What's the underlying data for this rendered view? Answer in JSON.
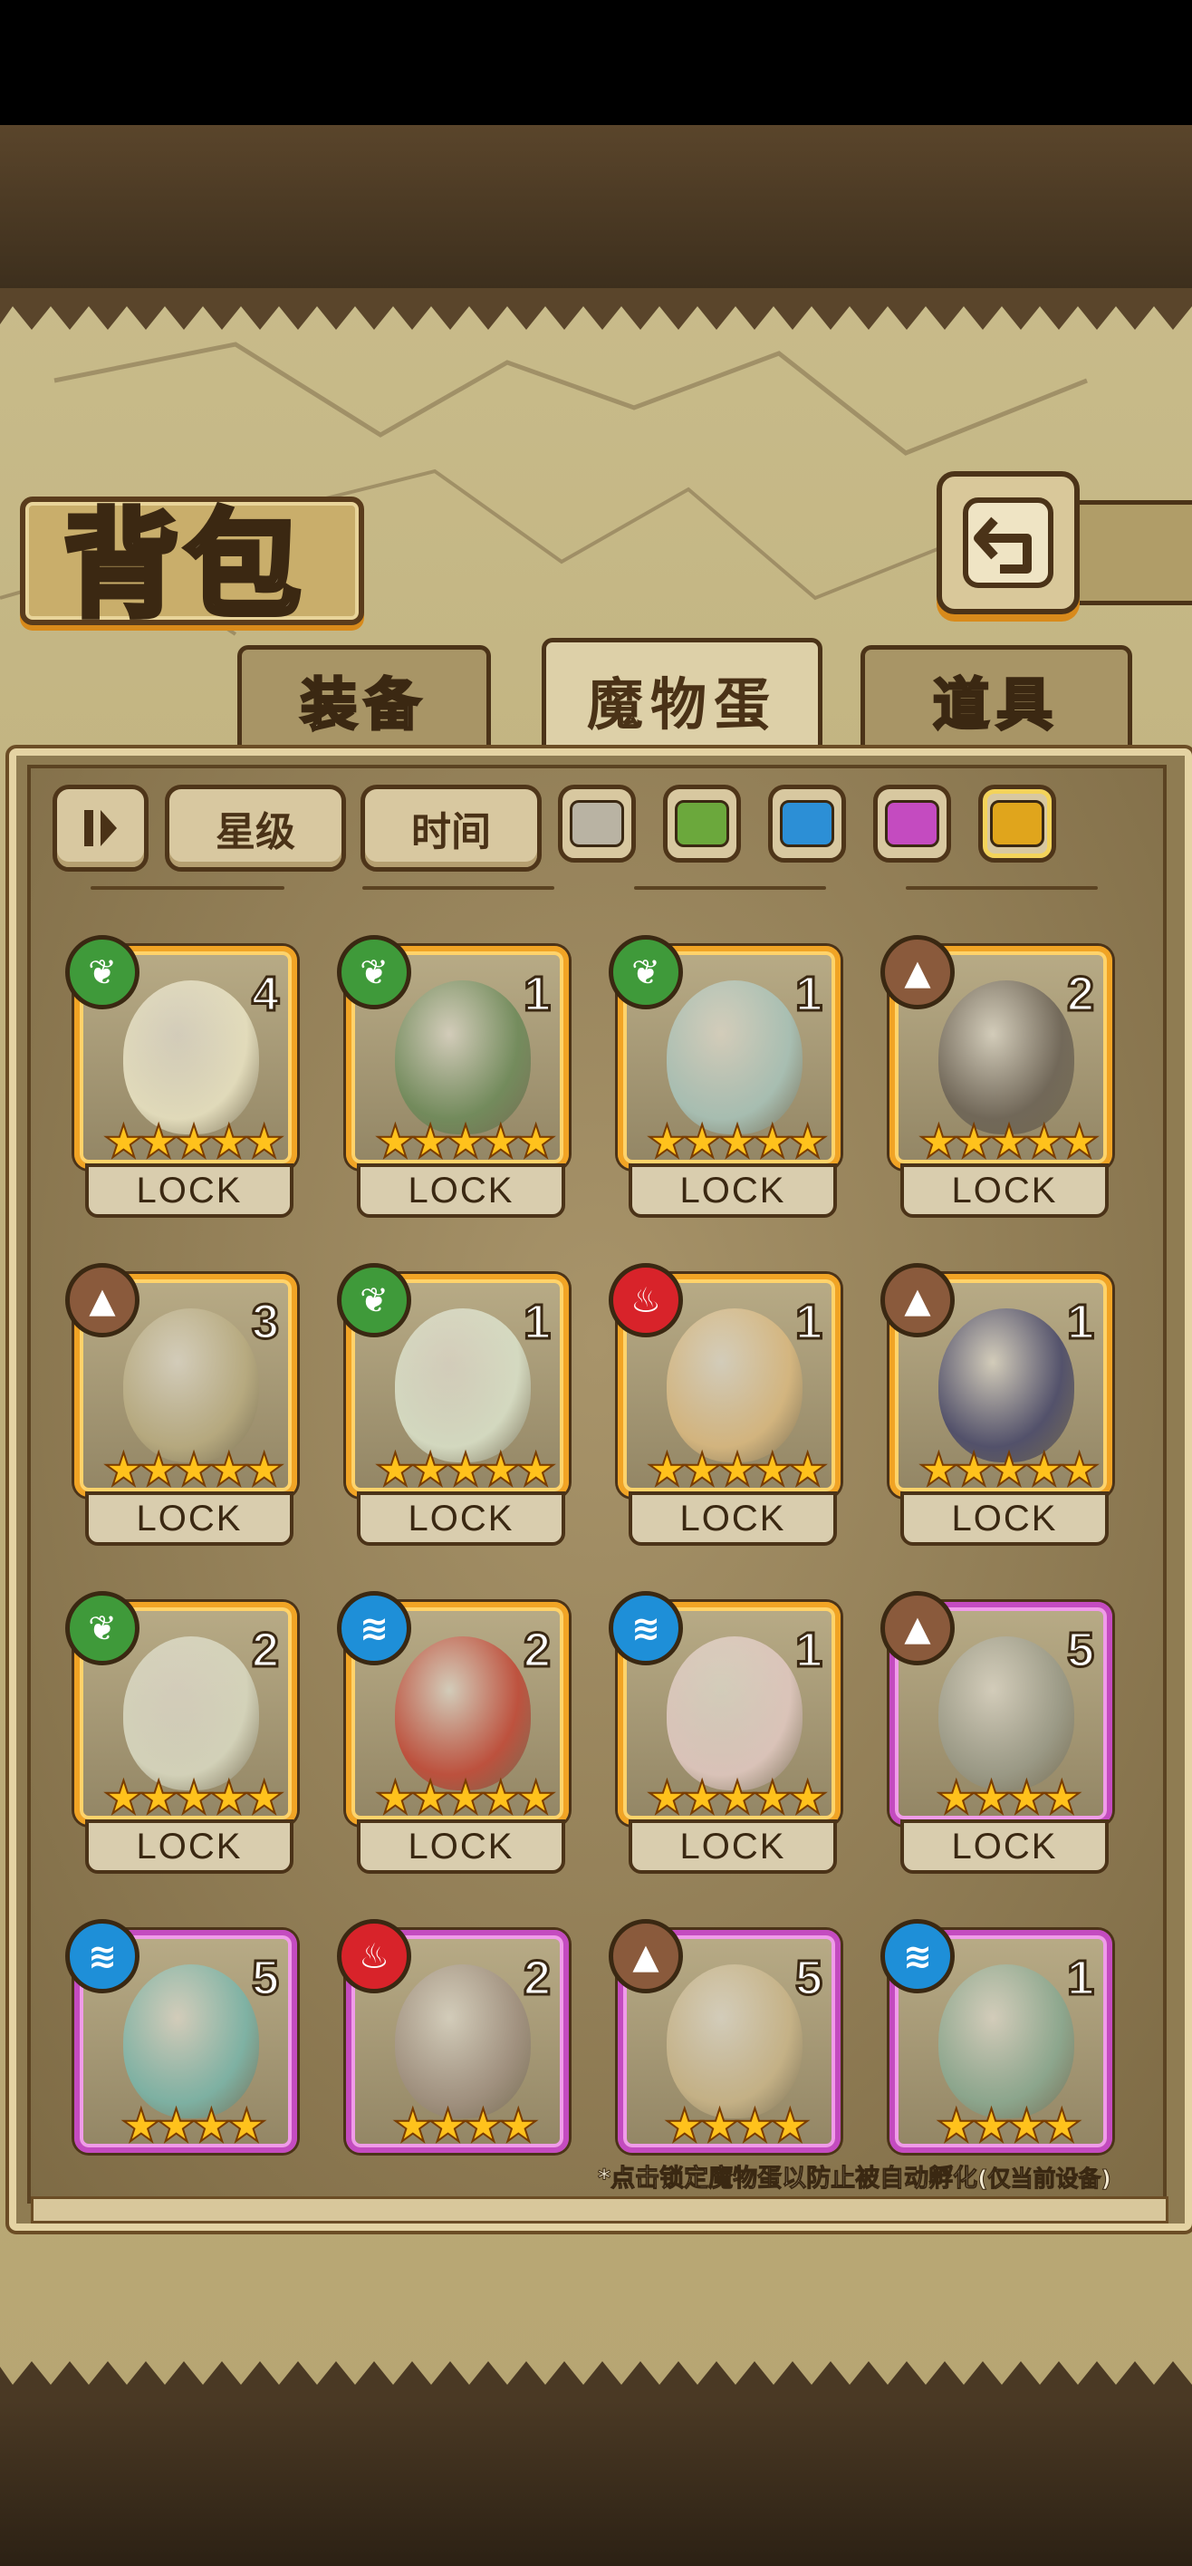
{
  "header": {
    "title": "背包",
    "back_icon": "return-arrow-icon"
  },
  "tabs": [
    {
      "label": "装备",
      "active": false
    },
    {
      "label": "魔物蛋",
      "active": true
    },
    {
      "label": "道具",
      "active": false
    }
  ],
  "filters": {
    "sort_icon": "sort-toggle-icon",
    "star_label": "星级",
    "time_label": "时间",
    "swatches": [
      {
        "name": "gray",
        "color": "#b9b3a3"
      },
      {
        "name": "green",
        "color": "#6ba83c"
      },
      {
        "name": "blue",
        "color": "#2c8fd6"
      },
      {
        "name": "purple",
        "color": "#c44bc0"
      },
      {
        "name": "gold",
        "color": "#e0a51c",
        "selected": true
      }
    ]
  },
  "element_colors": {
    "grass": "#3f9a3a",
    "earth": "#8a5a3c",
    "fire": "#d8232a",
    "water": "#1e8fd8"
  },
  "eggs": [
    {
      "element": "grass",
      "count": "4",
      "stars": "★★★★★",
      "rarity": "gold",
      "lock": "LOCK",
      "tint": "#e8e2c2"
    },
    {
      "element": "grass",
      "count": "1",
      "stars": "★★★★★",
      "rarity": "gold",
      "lock": "LOCK",
      "tint": "#6e8a5a"
    },
    {
      "element": "grass",
      "count": "1",
      "stars": "★★★★★",
      "rarity": "gold",
      "lock": "LOCK",
      "tint": "#a8c2b8"
    },
    {
      "element": "earth",
      "count": "2",
      "stars": "★★★★★",
      "rarity": "gold",
      "lock": "LOCK",
      "tint": "#6c6356"
    },
    {
      "element": "earth",
      "count": "3",
      "stars": "★★★★★",
      "rarity": "gold",
      "lock": "LOCK",
      "tint": "#b8ab80"
    },
    {
      "element": "grass",
      "count": "1",
      "stars": "★★★★★",
      "rarity": "gold",
      "lock": "LOCK",
      "tint": "#d9e0c8"
    },
    {
      "element": "fire",
      "count": "1",
      "stars": "★★★★★",
      "rarity": "gold",
      "lock": "LOCK",
      "tint": "#d8b880"
    },
    {
      "element": "earth",
      "count": "1",
      "stars": "★★★★★",
      "rarity": "gold",
      "lock": "LOCK",
      "tint": "#4a4a6a"
    },
    {
      "element": "grass",
      "count": "2",
      "stars": "★★★★★",
      "rarity": "gold",
      "lock": "LOCK",
      "tint": "#d8d8c0"
    },
    {
      "element": "water",
      "count": "2",
      "stars": "★★★★★",
      "rarity": "gold",
      "lock": "LOCK",
      "tint": "#c04a38"
    },
    {
      "element": "water",
      "count": "1",
      "stars": "★★★★★",
      "rarity": "gold",
      "lock": "LOCK",
      "tint": "#e0c8c0"
    },
    {
      "element": "earth",
      "count": "5",
      "stars": "★★★★",
      "rarity": "purple",
      "lock": "LOCK",
      "tint": "#9a9a88"
    },
    {
      "element": "water",
      "count": "5",
      "stars": "★★★★",
      "rarity": "purple",
      "lock": "",
      "tint": "#7ab4a8"
    },
    {
      "element": "fire",
      "count": "2",
      "stars": "★★★★",
      "rarity": "purple",
      "lock": "",
      "tint": "#a09080"
    },
    {
      "element": "earth",
      "count": "5",
      "stars": "★★★★",
      "rarity": "purple",
      "lock": "",
      "tint": "#c8b488"
    },
    {
      "element": "water",
      "count": "1",
      "stars": "★★★★",
      "rarity": "purple",
      "lock": "",
      "tint": "#8aa890"
    }
  ],
  "footnote": {
    "main": "*点击锁定魔物蛋以防止被自动孵化",
    "small": "(仅当前设备)"
  }
}
